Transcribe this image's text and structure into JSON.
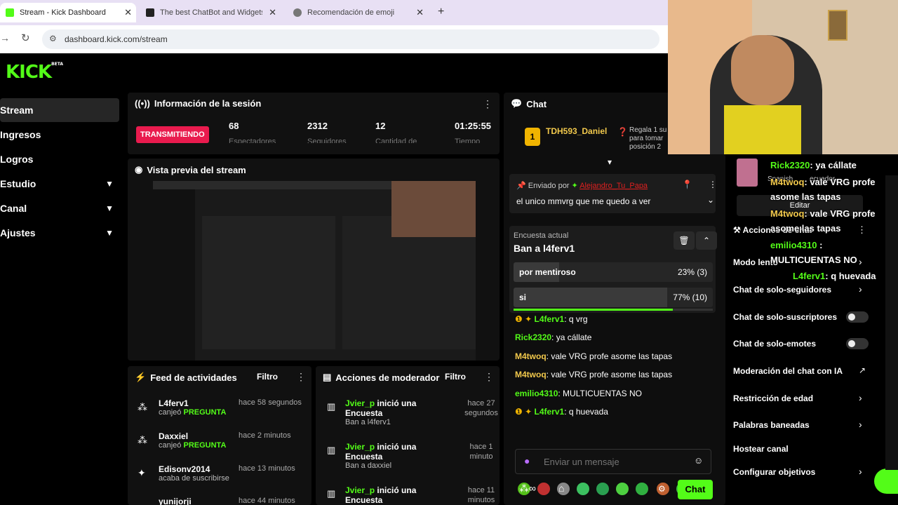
{
  "browser": {
    "tabs": [
      {
        "title": "Stream - Kick Dashboard",
        "fav": "#53fc18"
      },
      {
        "title": "The best ChatBot and Widgets",
        "fav": "#222"
      },
      {
        "title": "Recomendación de emoji",
        "fav": "#666"
      }
    ],
    "new_tab": "+",
    "url": "dashboard.kick.com/stream"
  },
  "app": {
    "logo": "KICK",
    "logo_tag": "BETA"
  },
  "sidebar": {
    "items": [
      {
        "label": "Stream",
        "expand": false
      },
      {
        "label": "Ingresos",
        "expand": false
      },
      {
        "label": "Logros",
        "expand": false
      },
      {
        "label": "Estudio",
        "expand": true
      },
      {
        "label": "Canal",
        "expand": true
      },
      {
        "label": "Ajustes",
        "expand": true
      }
    ]
  },
  "session": {
    "title": "Información de la sesión",
    "status": "TRANSMITIENDO",
    "stats": [
      {
        "value": "68",
        "label": "Espectadores"
      },
      {
        "value": "2312",
        "label": "Seguidores"
      },
      {
        "value": "12",
        "label": "Cantidad de"
      },
      {
        "value": "01:25:55",
        "label": "Tiempo"
      }
    ]
  },
  "preview": {
    "title": "Vista previa del stream"
  },
  "feed": {
    "title": "Feed de actividades",
    "filter": "Filtro",
    "items": [
      {
        "name": "L4ferv1",
        "action": "canjeó",
        "reward": "PREGUNTA",
        "time": "hace 58 segundos"
      },
      {
        "name": "Daxxiel",
        "action": "canjeó",
        "reward": "PREGUNTA",
        "time": "hace 2 minutos"
      },
      {
        "name": "Edisonv2014",
        "action": "acaba de suscribirse",
        "reward": "",
        "time": "hace 13 minutos"
      },
      {
        "name": "yunijorji",
        "action": "",
        "reward": "",
        "time": "hace 44 minutos"
      }
    ]
  },
  "modactions": {
    "title": "Acciones de moderador",
    "filter": "Filtro",
    "items": [
      {
        "name": "Jvier_p",
        "text": " inició una Encuesta",
        "sub": "Ban a l4ferv1",
        "time": "hace 27 segundos"
      },
      {
        "name": "Jvier_p",
        "text": " inició una Encuesta",
        "sub": "Ban a daxxiel",
        "time": "hace 1 minuto"
      },
      {
        "name": "Jvier_p",
        "text": " inició una Encuesta",
        "sub": "",
        "time": "hace 11 minutos"
      }
    ]
  },
  "chat": {
    "title": "Chat",
    "top_user": "TDH593_Daniel",
    "top_user_count": "1",
    "gift_text": "Regala 1 su",
    "gift_text2": "para tomar",
    "gift_text3": "posición 2",
    "pinned": {
      "by_label": "Enviado por",
      "by_user": "Alejandro_Tu_Papa",
      "text": "el unico mmvrg que me quedo a ver"
    },
    "poll": {
      "label": "Encuesta actual",
      "question": "Ban a l4ferv1",
      "options": [
        {
          "text": "por mentiroso",
          "result": "23% (3)",
          "fraction": 0.23
        },
        {
          "text": "si",
          "result": "77% (10)",
          "fraction": 0.77
        }
      ],
      "timer_fraction": 0.8
    },
    "messages": [
      {
        "user": "L4ferv1",
        "text": "q vrg",
        "color": "#53fc18",
        "badges": true
      },
      {
        "user": "Rick2320",
        "text": "ya cállate",
        "color": "#53fc18",
        "badges": false
      },
      {
        "user": "M4twoq",
        "text": "vale VRG profe asome las tapas",
        "color": "#f2c94c",
        "badges": false
      },
      {
        "user": "M4twoq",
        "text": "vale VRG profe asome las tapas",
        "color": "#f2c94c",
        "badges": false
      },
      {
        "user": "emilio4310",
        "text": "MULTICUENTAS NO",
        "color": "#53fc18",
        "badges": false
      },
      {
        "user": "L4ferv1",
        "text": "q huevada",
        "color": "#53fc18",
        "badges": true
      }
    ],
    "input_placeholder": "Enviar un mensaje",
    "send_label": "Chat"
  },
  "right": {
    "rows": [
      {
        "label": "Acciones de chat"
      },
      {
        "label": "Modo lento"
      },
      {
        "label": "Chat de solo-seguidores"
      },
      {
        "label": "Chat de solo-suscriptores"
      },
      {
        "label": "Chat de solo-emotes"
      },
      {
        "label": "Moderación del chat con IA"
      },
      {
        "label": "Restricción de edad"
      },
      {
        "label": "Palabras baneadas"
      },
      {
        "label": "Hostear canal"
      },
      {
        "label": "Configurar objetivos"
      }
    ],
    "edit_label": "Editar",
    "lang_label": "Spanish",
    "lang_label2": "ecuador"
  },
  "overlay": {
    "lines": [
      {
        "user": "Rick2320",
        "text": ": ya cállate",
        "color": "#53fc18"
      },
      {
        "user": "M4twoq",
        "text": ": vale VRG profe",
        "color": "#f2c94c"
      },
      {
        "user": "",
        "text": "asome las tapas",
        "color": "#fff"
      },
      {
        "user": "M4twoq",
        "text": ": vale VRG profe",
        "color": "#f2c94c"
      },
      {
        "user": "",
        "text": "asome las tapas",
        "color": "#fff"
      },
      {
        "user": "emilio4310",
        "text": " :",
        "color": "#53fc18"
      },
      {
        "user": "",
        "text": "MULTICUENTAS NO",
        "color": "#fff"
      },
      {
        "user": "L4ferv1",
        "text": ": q huevada",
        "color": "#53fc18"
      }
    ]
  },
  "colors": {
    "accent": "#53fc18",
    "live": "#e91b4e",
    "poll_bar": "#2e2e2e"
  }
}
